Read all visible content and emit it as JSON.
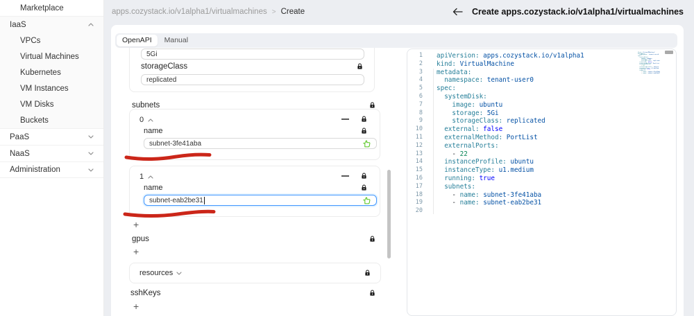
{
  "colors": {
    "annotation_red": "#cb2619",
    "focus_blue": "#4096ff",
    "like_green": "#52c41a",
    "key_teal": "#267f99",
    "value_navy": "#0451a5"
  },
  "sidebar": {
    "items": [
      {
        "label": "Marketplace",
        "kind": "item"
      },
      {
        "label": "IaaS",
        "kind": "header",
        "chevron": "up",
        "grouped": true
      },
      {
        "label": "VPCs",
        "kind": "sub",
        "grouped": true
      },
      {
        "label": "Virtual Machines",
        "kind": "sub",
        "grouped": true
      },
      {
        "label": "Kubernetes",
        "kind": "sub",
        "grouped": true
      },
      {
        "label": "VM Instances",
        "kind": "sub",
        "grouped": true
      },
      {
        "label": "VM Disks",
        "kind": "sub",
        "grouped": true
      },
      {
        "label": "Buckets",
        "kind": "sub",
        "grouped": true
      },
      {
        "label": "PaaS",
        "kind": "header",
        "chevron": "down"
      },
      {
        "label": "NaaS",
        "kind": "header",
        "chevron": "down"
      },
      {
        "label": "Administration",
        "kind": "header",
        "chevron": "down",
        "last": true
      }
    ]
  },
  "header": {
    "breadcrumb": {
      "root": "apps.cozystack.io/v1alpha1/virtualmachines",
      "separator": ">",
      "current": "Create"
    },
    "title": "Create apps.cozystack.io/v1alpha1/virtualmachines"
  },
  "tabs": {
    "openapi": "OpenAPI",
    "manual": "Manual",
    "active": "OpenAPI"
  },
  "form": {
    "top_partial_input": {
      "value": "5Gi"
    },
    "storage_class": {
      "label": "storageClass",
      "value": "replicated"
    },
    "subnets": {
      "label": "subnets",
      "items": [
        {
          "index": "0",
          "field_label": "name",
          "value": "subnet-3fe41aba",
          "focused": false
        },
        {
          "index": "1",
          "field_label": "name",
          "value": "subnet-eab2be31",
          "focused": true
        }
      ],
      "add_label": "+"
    },
    "gpus": {
      "label": "gpus",
      "add_label": "+"
    },
    "resources": {
      "label": "resources"
    },
    "ssh_keys": {
      "label": "sshKeys",
      "add_label": "+"
    }
  },
  "editor": {
    "lines": [
      {
        "n": "1",
        "seg": [
          {
            "c": "key",
            "t": "apiVersion:"
          },
          {
            "c": "val",
            "t": " apps.cozystack.io/v1alpha1"
          }
        ]
      },
      {
        "n": "2",
        "seg": [
          {
            "c": "key",
            "t": "kind:"
          },
          {
            "c": "val",
            "t": " VirtualMachine"
          }
        ]
      },
      {
        "n": "3",
        "seg": [
          {
            "c": "key",
            "t": "metadata:"
          }
        ]
      },
      {
        "n": "4",
        "seg": [
          {
            "c": "txt",
            "t": "  "
          },
          {
            "c": "key",
            "t": "namespace:"
          },
          {
            "c": "val",
            "t": " tenant-user0"
          }
        ]
      },
      {
        "n": "5",
        "seg": [
          {
            "c": "key",
            "t": "spec:"
          }
        ]
      },
      {
        "n": "6",
        "seg": [
          {
            "c": "txt",
            "t": "  "
          },
          {
            "c": "key",
            "t": "systemDisk:"
          }
        ]
      },
      {
        "n": "7",
        "seg": [
          {
            "c": "txt",
            "t": "    "
          },
          {
            "c": "key",
            "t": "image:"
          },
          {
            "c": "val",
            "t": " ubuntu"
          }
        ]
      },
      {
        "n": "8",
        "seg": [
          {
            "c": "txt",
            "t": "    "
          },
          {
            "c": "key",
            "t": "storage:"
          },
          {
            "c": "val",
            "t": " 5Gi"
          }
        ]
      },
      {
        "n": "9",
        "seg": [
          {
            "c": "txt",
            "t": "    "
          },
          {
            "c": "key",
            "t": "storageClass:"
          },
          {
            "c": "val",
            "t": " replicated"
          }
        ]
      },
      {
        "n": "10",
        "seg": [
          {
            "c": "txt",
            "t": "  "
          },
          {
            "c": "key",
            "t": "external:"
          },
          {
            "c": "bool",
            "t": " false"
          }
        ]
      },
      {
        "n": "11",
        "seg": [
          {
            "c": "txt",
            "t": "  "
          },
          {
            "c": "key",
            "t": "externalMethod:"
          },
          {
            "c": "val",
            "t": " PortList"
          }
        ]
      },
      {
        "n": "12",
        "seg": [
          {
            "c": "txt",
            "t": "  "
          },
          {
            "c": "key",
            "t": "externalPorts:"
          }
        ]
      },
      {
        "n": "13",
        "seg": [
          {
            "c": "txt",
            "t": "    - "
          },
          {
            "c": "num",
            "t": "22"
          }
        ]
      },
      {
        "n": "14",
        "seg": [
          {
            "c": "txt",
            "t": "  "
          },
          {
            "c": "key",
            "t": "instanceProfile:"
          },
          {
            "c": "val",
            "t": " ubuntu"
          }
        ]
      },
      {
        "n": "15",
        "seg": [
          {
            "c": "txt",
            "t": "  "
          },
          {
            "c": "key",
            "t": "instanceType:"
          },
          {
            "c": "val",
            "t": " u1.medium"
          }
        ]
      },
      {
        "n": "16",
        "seg": [
          {
            "c": "txt",
            "t": "  "
          },
          {
            "c": "key",
            "t": "running:"
          },
          {
            "c": "bool",
            "t": " true"
          }
        ]
      },
      {
        "n": "17",
        "seg": [
          {
            "c": "txt",
            "t": "  "
          },
          {
            "c": "key",
            "t": "subnets:"
          }
        ]
      },
      {
        "n": "18",
        "seg": [
          {
            "c": "txt",
            "t": "    - "
          },
          {
            "c": "key",
            "t": "name:"
          },
          {
            "c": "val",
            "t": " subnet-3fe41aba"
          }
        ]
      },
      {
        "n": "19",
        "seg": [
          {
            "c": "txt",
            "t": "    - "
          },
          {
            "c": "key",
            "t": "name:"
          },
          {
            "c": "val",
            "t": " subnet-eab2be31"
          }
        ]
      },
      {
        "n": "20",
        "seg": []
      }
    ]
  }
}
